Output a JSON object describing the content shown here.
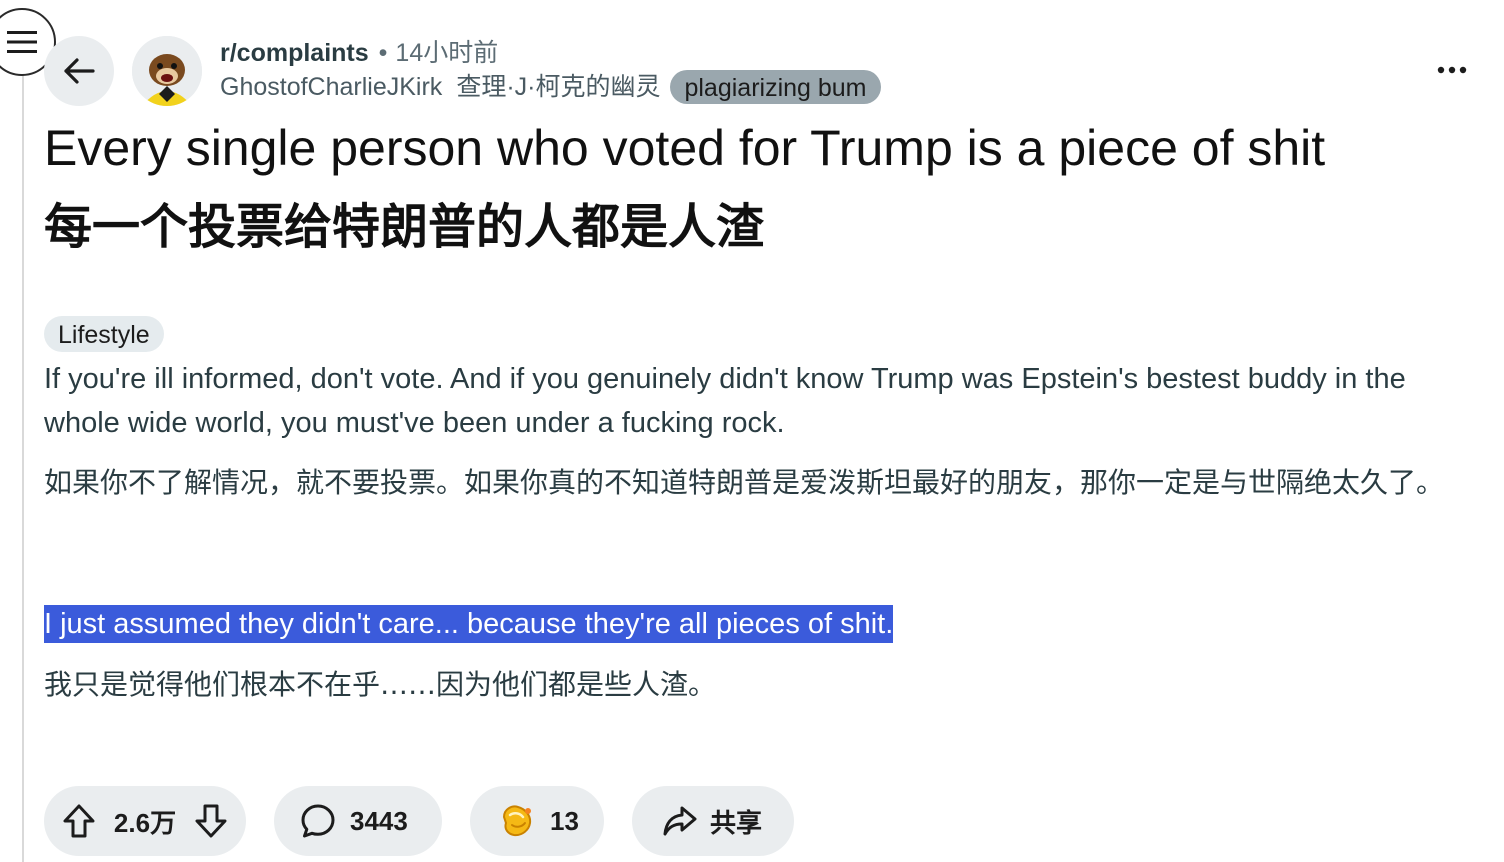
{
  "header": {
    "subreddit": "r/complaints",
    "separator": "•",
    "time_ago": "14小时前",
    "username": "GhostofCharlieJKirk",
    "username_cn": "查理·J·柯克的幽灵",
    "user_flair": "plagiarizing bum",
    "more_label": "..."
  },
  "post": {
    "title_en": "Every single person who voted for Trump is a piece of shit",
    "title_cn": "每一个投票给特朗普的人都是人渣",
    "flair": "Lifestyle",
    "paragraph_1": "If you're ill informed, don't vote. And if you genuinely didn't know Trump was Epstein's bestest buddy in the whole wide world, you must've been under a fucking rock.",
    "paragraph_2": "如果你不了解情况，就不要投票。如果你真的不知道特朗普是爱泼斯坦最好的朋友，那你一定是与世隔绝太久了。",
    "paragraph_3": "I just assumed they didn't care... because they're all pieces of shit.",
    "paragraph_4": "我只是觉得他们根本不在乎……因为他们都是些人渣。"
  },
  "actions": {
    "vote_count": "2.6万",
    "comment_count": "3443",
    "award_count": "13",
    "share_label": "共享"
  },
  "icons": {
    "menu": "hamburger-menu-icon",
    "back": "arrow-left-icon",
    "more": "ellipsis-icon",
    "upvote": "arrow-up-icon",
    "downvote": "arrow-down-icon",
    "comment": "speech-bubble-icon",
    "award": "award-icon",
    "share": "share-arrow-icon"
  },
  "colors": {
    "highlight": "#3b5bdb",
    "pill_bg": "#eaedef",
    "user_flair_bg": "#9aa7ae"
  }
}
